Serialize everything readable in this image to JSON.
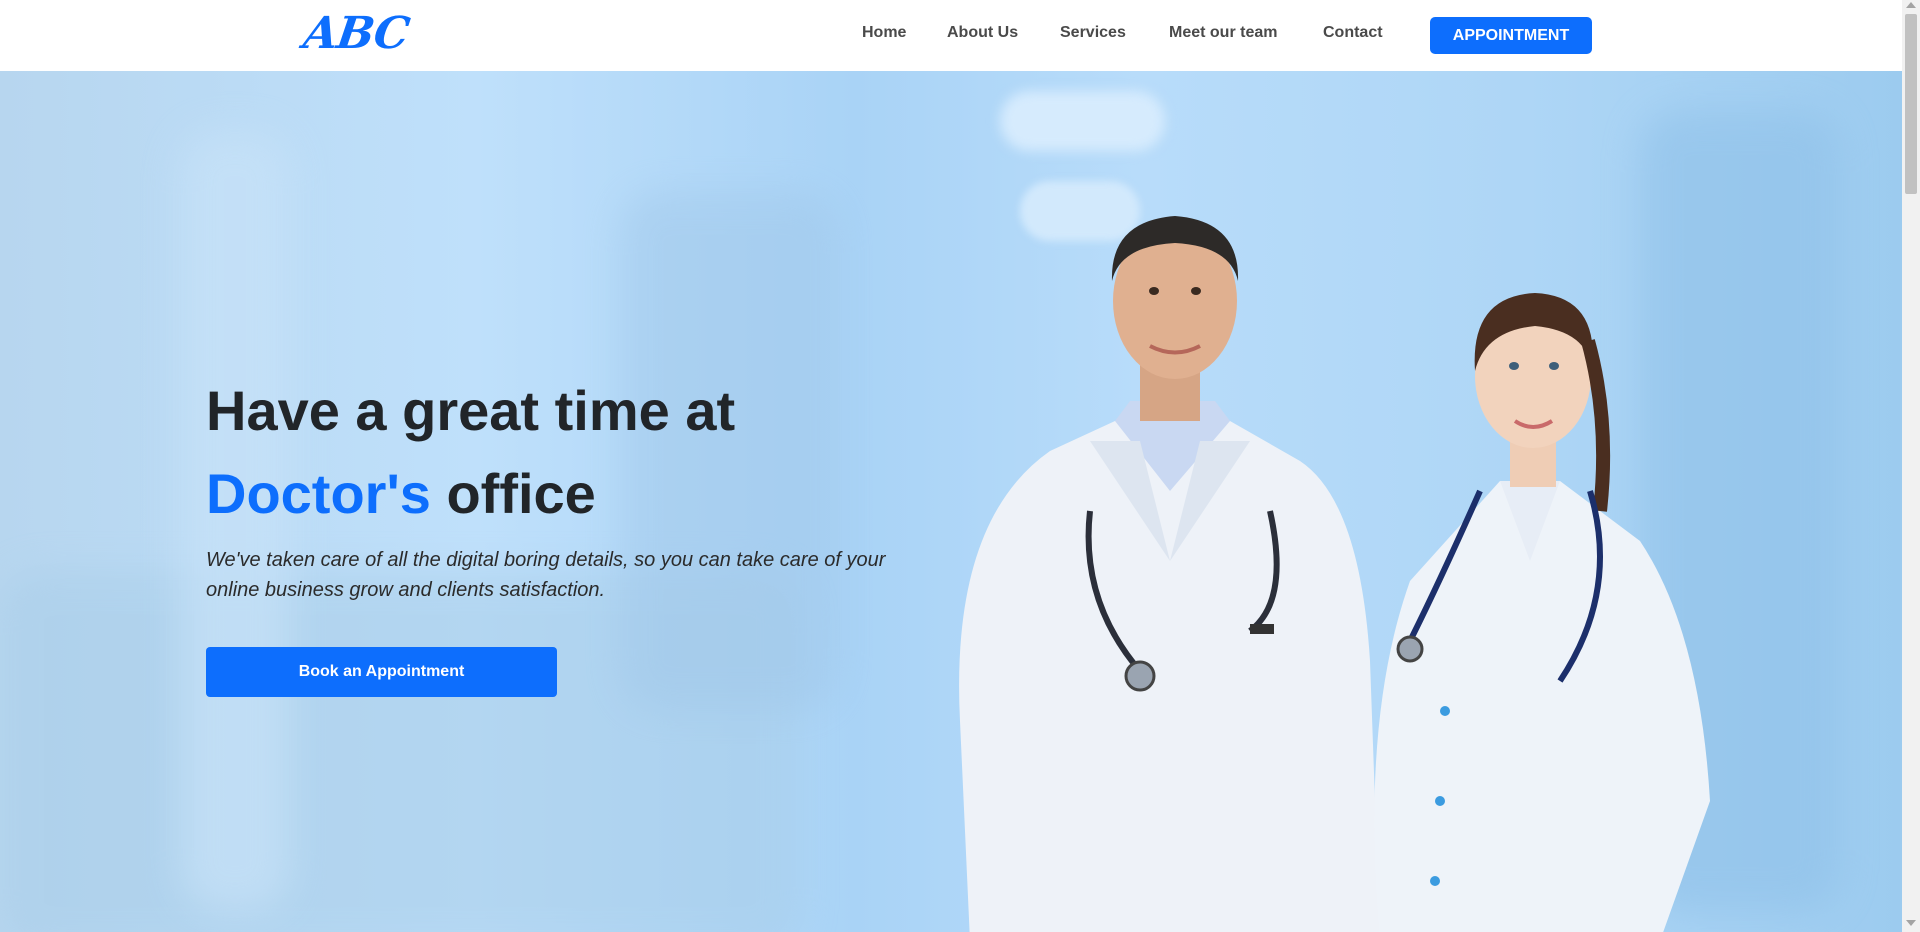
{
  "header": {
    "logo": "ABC",
    "nav": [
      "Home",
      "About Us",
      "Services",
      "Meet our team",
      "Contact"
    ],
    "cta_label": "APPOINTMENT"
  },
  "hero": {
    "title_line1": "Have a great time at",
    "title_accent": "Doctor's",
    "title_rest": "office",
    "subtitle": "We've taken care of all the digital boring details, so you can take care of your online business grow and clients satisfaction.",
    "button_label": "Book an Appointment"
  },
  "colors": {
    "primary": "#0d6efd",
    "heading": "#212529",
    "nav_text": "#4a4a4a",
    "hero_background": "#b8dcfa"
  }
}
